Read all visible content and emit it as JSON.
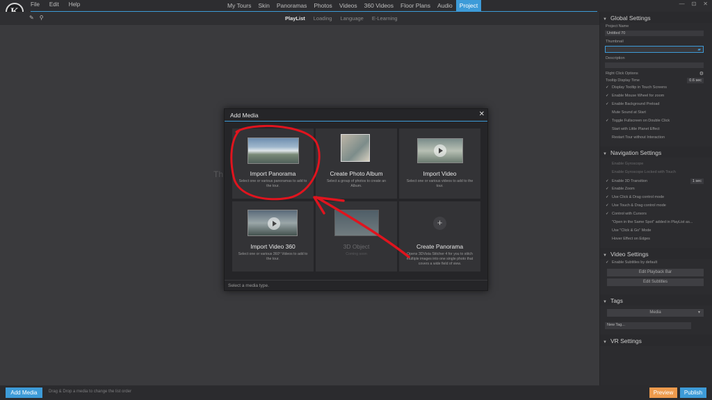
{
  "app": {
    "logo_text": "K",
    "menu": [
      "File",
      "Edit",
      "Help"
    ],
    "nav": [
      "My Tours",
      "Skin",
      "Panoramas",
      "Photos",
      "Videos",
      "360 Videos",
      "Floor Plans",
      "Audio",
      "Project"
    ],
    "nav_active": "Project",
    "window_controls": [
      "—",
      "⊡",
      "✕"
    ]
  },
  "subbar": {
    "icons": [
      "tag-icon",
      "search-icon"
    ],
    "tabs": [
      "PlayList",
      "Loading",
      "Language",
      "E-Learning"
    ],
    "active_tab": "PlayList"
  },
  "background_text": "Th",
  "panel": {
    "global": {
      "title": "Global Settings",
      "project_name_label": "Project Name",
      "project_name_value": "Untitled 70",
      "thumbnail_label": "Thumbnail",
      "description_label": "Description",
      "right_click_label": "Right Click Options",
      "tooltip_label": "Tooltip Display Time",
      "tooltip_value": "0.6 sec",
      "options": [
        {
          "label": "Display Tooltip in Touch Screens",
          "checked": true
        },
        {
          "label": "Enable Mouse Wheel for zoom",
          "checked": true
        },
        {
          "label": "Enable Background Preload",
          "checked": true
        },
        {
          "label": "Mute Sound at Start",
          "checked": false
        },
        {
          "label": "Toggle Fullscreen on Double Click",
          "checked": true
        },
        {
          "label": "Start with Little Planet Effect",
          "checked": false
        },
        {
          "label": "Restart Tour without Interaction",
          "checked": false
        }
      ]
    },
    "navigation": {
      "title": "Navigation Settings",
      "options": [
        {
          "label": "Enable Gyroscope",
          "checked": false,
          "dim": true
        },
        {
          "label": "Enable Gyroscope Locked with Touch",
          "checked": false,
          "dim": true
        },
        {
          "label": "Enable 3D Transition",
          "checked": true,
          "value": "1 sec"
        },
        {
          "label": "Enable Zoom",
          "checked": true
        },
        {
          "label": "Use Click & Drag control mode",
          "checked": true
        },
        {
          "label": "Use Touch & Drag control mode",
          "checked": true
        },
        {
          "label": "Control with Cursors",
          "checked": true
        },
        {
          "label": "\"Open in the Same Spot\" added in PlayList as...",
          "checked": false
        },
        {
          "label": "Use \"Click & Go\" Mode",
          "checked": false
        },
        {
          "label": "Hover Effect on Edges",
          "checked": false
        }
      ]
    },
    "video": {
      "title": "Video Settings",
      "subtitles_label": "Enable Subtitles by default",
      "btn_playback": "Edit Playback Bar",
      "btn_subtitles": "Edit Subtitles"
    },
    "tags": {
      "title": "Tags",
      "select_value": "Media",
      "new_tag_placeholder": "New Tag..."
    },
    "vr": {
      "title": "VR Settings"
    }
  },
  "bottom": {
    "add_media": "Add Media",
    "hint": "Drag & Drop a media to change the list order",
    "preview": "Preview",
    "publish": "Publish"
  },
  "modal": {
    "title": "Add Media",
    "close": "✕",
    "tiles": [
      {
        "title": "Import Panorama",
        "desc": "Select one or various panoramas to add to the tour."
      },
      {
        "title": "Create Photo Album",
        "desc": "Select a group of photos to create an Album."
      },
      {
        "title": "Import Video",
        "desc": "Select one or various videos to add to the tour."
      },
      {
        "title": "Import Video 360",
        "desc": "Select one or various 360° Videos to add to the tour."
      },
      {
        "title": "3D Object",
        "desc": "Coming soon"
      },
      {
        "title": "Create Panorama",
        "desc": "Opens 3DVista Stitcher 4 for you to stitch multiple images into one single photo that covers a wide field of view."
      }
    ],
    "footer": "Select a media type."
  },
  "colors": {
    "accent": "#3d9bd8",
    "preview": "#ee9b4d",
    "annotation": "#e0141e"
  }
}
